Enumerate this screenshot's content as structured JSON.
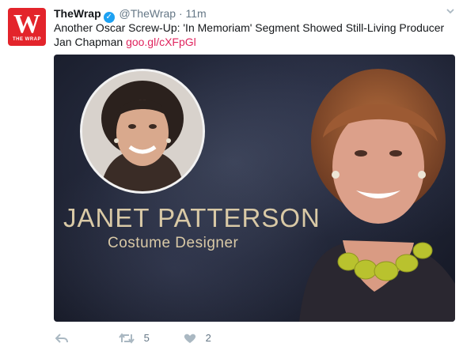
{
  "tweet": {
    "account_name": "TheWrap",
    "handle": "@TheWrap",
    "separator": "·",
    "time": "11m",
    "text": "Another Oscar Screw-Up: 'In Memoriam' Segment Showed Still-Living Producer Jan Chapman",
    "link": "goo.gl/cXFpGl"
  },
  "avatar": {
    "letter": "W",
    "tagline": "THE WRAP"
  },
  "media": {
    "memoriam_name": "JANET PATTERSON",
    "memoriam_role": "Costume Designer"
  },
  "actions": {
    "reply_count": "",
    "retweet_count": "5",
    "like_count": "2"
  },
  "colors": {
    "brand": "#e3242b",
    "link": "#e0245e",
    "verified": "#1da1f2",
    "muted": "#657786"
  },
  "icons": [
    "verified-icon",
    "reply-icon",
    "retweet-icon",
    "like-icon",
    "caret-down-icon"
  ]
}
